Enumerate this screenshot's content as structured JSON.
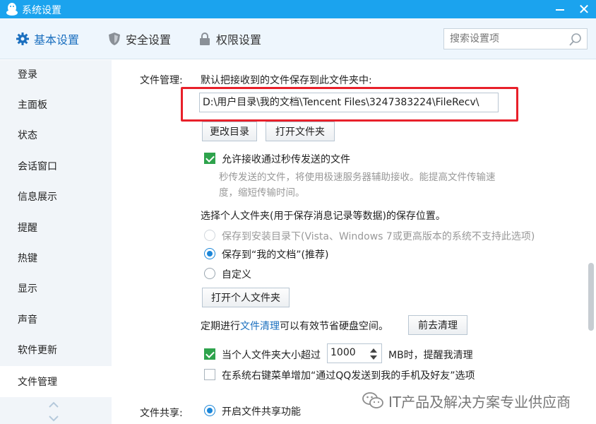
{
  "window": {
    "title": "系统设置"
  },
  "tabs": [
    {
      "label": "基本设置",
      "icon": "gear-icon",
      "active": true
    },
    {
      "label": "安全设置",
      "icon": "shield-icon",
      "active": false
    },
    {
      "label": "权限设置",
      "icon": "lock-icon",
      "active": false
    }
  ],
  "search": {
    "placeholder": "搜索设置项"
  },
  "sidebar": {
    "items": [
      {
        "label": "登录"
      },
      {
        "label": "主面板"
      },
      {
        "label": "状态"
      },
      {
        "label": "会话窗口"
      },
      {
        "label": "信息展示"
      },
      {
        "label": "提醒"
      },
      {
        "label": "热键"
      },
      {
        "label": "显示"
      },
      {
        "label": "声音"
      },
      {
        "label": "软件更新"
      },
      {
        "label": "文件管理",
        "active": true
      }
    ]
  },
  "file_management": {
    "section_label": "文件管理:",
    "save_desc": "默认把接收到的文件保存到此文件夹中:",
    "path": "D:\\用户目录\\我的文档\\Tencent Files\\3247383224\\FileRecv\\",
    "change_dir_label": "更改目录",
    "open_folder_label": "打开文件夹",
    "allow_instant_label": "允许接收通过秒传发送的文件",
    "allow_instant_checked": true,
    "instant_desc_line1": "秒传发送的文件，将使用极速服务器辅助接收。能提高文件传输速",
    "instant_desc_line2": "度，缩短传输时间。",
    "personal_folder_desc": "选择个人文件夹(用于保存消息记录等数据)的保存位置。",
    "radio_install_dir": "保存到安装目录下(Vista、Windows 7或更高版本的系统不支持此选项)",
    "radio_my_docs": "保存到“我的文档”(推荐)",
    "radio_custom": "自定义",
    "open_personal_label": "打开个人文件夹",
    "cleanup_prefix": "定期进行",
    "cleanup_link": "文件清理",
    "cleanup_suffix": "可以有效节省硬盘空间。",
    "go_cleanup_label": "前去清理",
    "size_remind_prefix": "当个人文件夹大小超过",
    "size_value": "1000",
    "size_remind_suffix": "MB时，提醒我清理",
    "size_remind_checked": true,
    "context_menu_label": "在系统右键菜单增加“通过QQ发送到我的手机及好友”选项",
    "context_menu_checked": false
  },
  "file_sharing": {
    "section_label": "文件共享:",
    "enable_label": "开启文件共享功能"
  },
  "watermark": {
    "text": "IT产品及解决方案专业供应商"
  },
  "colors": {
    "titlebar": "#1ba3ee",
    "accent": "#1a6fbf",
    "highlight": "#e8202a",
    "check_green": "#2ea34c"
  }
}
